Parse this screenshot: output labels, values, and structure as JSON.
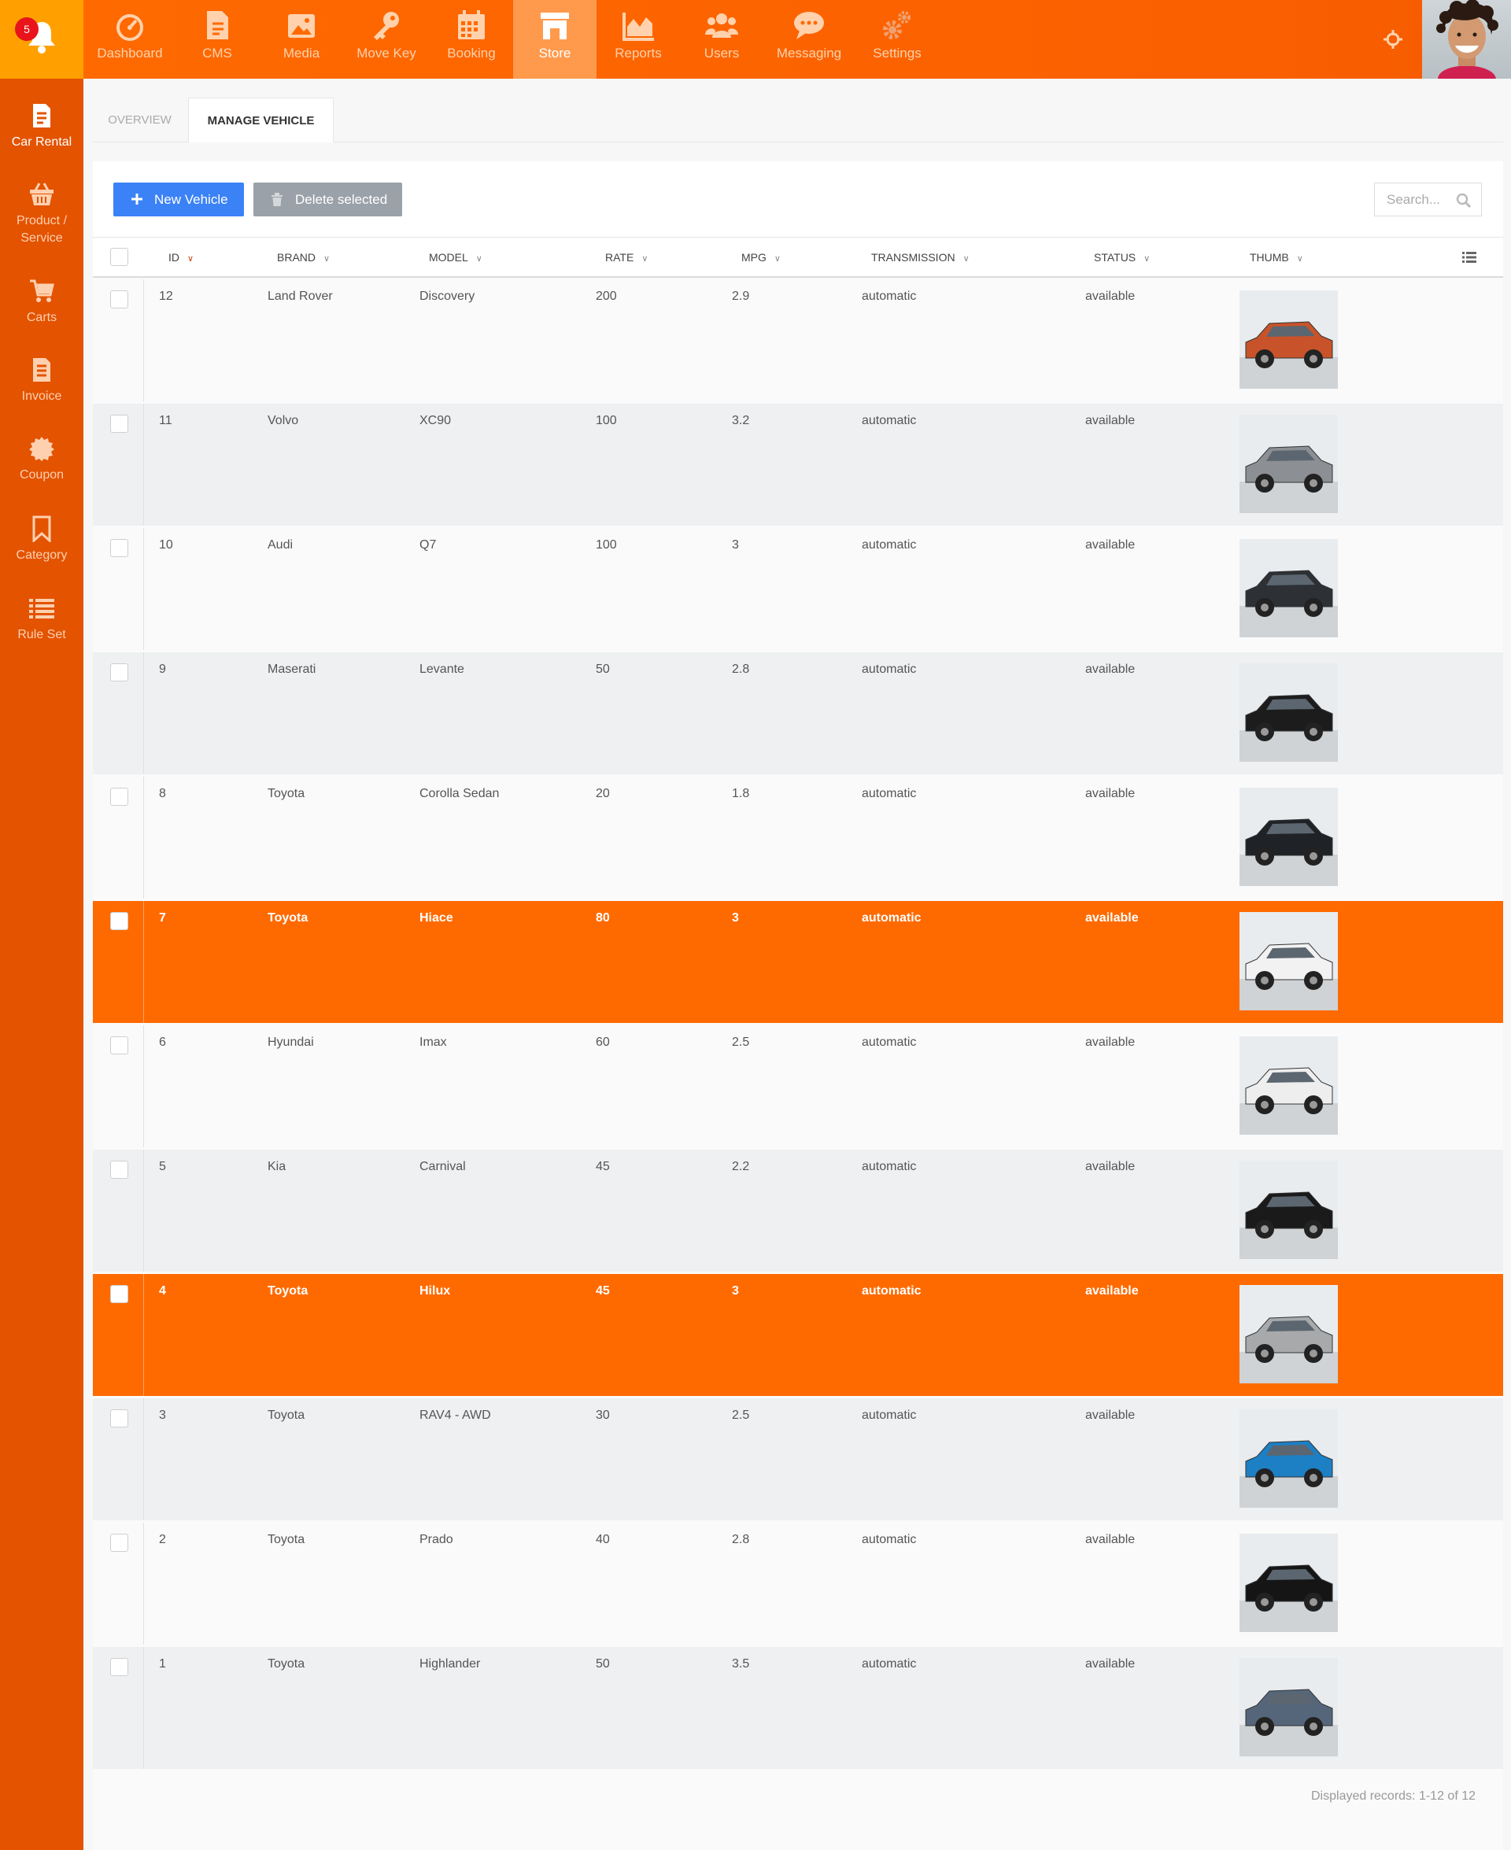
{
  "notifications": {
    "count": "5"
  },
  "topnav": [
    {
      "label": "Dashboard",
      "icon": "dashboard-icon"
    },
    {
      "label": "CMS",
      "icon": "cms-icon"
    },
    {
      "label": "Media",
      "icon": "media-icon"
    },
    {
      "label": "Move Key",
      "icon": "key-icon"
    },
    {
      "label": "Booking",
      "icon": "calendar-icon"
    },
    {
      "label": "Store",
      "icon": "store-icon",
      "active": true
    },
    {
      "label": "Reports",
      "icon": "chart-icon"
    },
    {
      "label": "Users",
      "icon": "users-icon"
    },
    {
      "label": "Messaging",
      "icon": "chat-icon"
    },
    {
      "label": "Settings",
      "icon": "gears-icon"
    }
  ],
  "sidebar": [
    {
      "label": "Car Rental",
      "icon": "document-icon",
      "active": true
    },
    {
      "label": "Product / Service",
      "icon": "basket-icon"
    },
    {
      "label": "Carts",
      "icon": "cart-icon"
    },
    {
      "label": "Invoice",
      "icon": "invoice-icon"
    },
    {
      "label": "Coupon",
      "icon": "badge-icon"
    },
    {
      "label": "Category",
      "icon": "bookmark-icon"
    },
    {
      "label": "Rule Set",
      "icon": "list-icon"
    }
  ],
  "tabs": [
    {
      "label": "OVERVIEW"
    },
    {
      "label": "MANAGE VEHICLE",
      "active": true
    }
  ],
  "toolbar": {
    "new_label": "New Vehicle",
    "delete_label": "Delete selected",
    "search_placeholder": "Search..."
  },
  "table": {
    "columns": [
      "ID",
      "BRAND",
      "MODEL",
      "RATE",
      "MPG",
      "TRANSMISSION",
      "STATUS",
      "THUMB"
    ],
    "rows": [
      {
        "id": "12",
        "brand": "Land Rover",
        "model": "Discovery",
        "rate": "200",
        "mpg": "2.9",
        "transmission": "automatic",
        "status": "available",
        "selected": false,
        "car_color": "#c8532a"
      },
      {
        "id": "11",
        "brand": "Volvo",
        "model": "XC90",
        "rate": "100",
        "mpg": "3.2",
        "transmission": "automatic",
        "status": "available",
        "selected": false,
        "car_color": "#8c8f93"
      },
      {
        "id": "10",
        "brand": "Audi",
        "model": "Q7",
        "rate": "100",
        "mpg": "3",
        "transmission": "automatic",
        "status": "available",
        "selected": false,
        "car_color": "#2d3034"
      },
      {
        "id": "9",
        "brand": "Maserati",
        "model": "Levante",
        "rate": "50",
        "mpg": "2.8",
        "transmission": "automatic",
        "status": "available",
        "selected": false,
        "car_color": "#1c1c1c"
      },
      {
        "id": "8",
        "brand": "Toyota",
        "model": "Corolla Sedan",
        "rate": "20",
        "mpg": "1.8",
        "transmission": "automatic",
        "status": "available",
        "selected": false,
        "car_color": "#1f2226"
      },
      {
        "id": "7",
        "brand": "Toyota",
        "model": "Hiace",
        "rate": "80",
        "mpg": "3",
        "transmission": "automatic",
        "status": "available",
        "selected": true,
        "car_color": "#f2f2f2"
      },
      {
        "id": "6",
        "brand": "Hyundai",
        "model": "Imax",
        "rate": "60",
        "mpg": "2.5",
        "transmission": "automatic",
        "status": "available",
        "selected": false,
        "car_color": "#eeeeee"
      },
      {
        "id": "5",
        "brand": "Kia",
        "model": "Carnival",
        "rate": "45",
        "mpg": "2.2",
        "transmission": "automatic",
        "status": "available",
        "selected": false,
        "car_color": "#1a1a1a"
      },
      {
        "id": "4",
        "brand": "Toyota",
        "model": "Hilux",
        "rate": "45",
        "mpg": "3",
        "transmission": "automatic",
        "status": "available",
        "selected": true,
        "car_color": "#a7a9ab"
      },
      {
        "id": "3",
        "brand": "Toyota",
        "model": "RAV4 - AWD",
        "rate": "30",
        "mpg": "2.5",
        "transmission": "automatic",
        "status": "available",
        "selected": false,
        "car_color": "#1d7fc4"
      },
      {
        "id": "2",
        "brand": "Toyota",
        "model": "Prado",
        "rate": "40",
        "mpg": "2.8",
        "transmission": "automatic",
        "status": "available",
        "selected": false,
        "car_color": "#151515"
      },
      {
        "id": "1",
        "brand": "Toyota",
        "model": "Highlander",
        "rate": "50",
        "mpg": "3.5",
        "transmission": "automatic",
        "status": "available",
        "selected": false,
        "car_color": "#56667a"
      }
    ]
  },
  "footer": {
    "records": "Displayed records: 1-12 of 12"
  },
  "colors": {
    "accent": "#ff6a00",
    "sidebar": "#e35300",
    "primary_button": "#3b82f6"
  }
}
